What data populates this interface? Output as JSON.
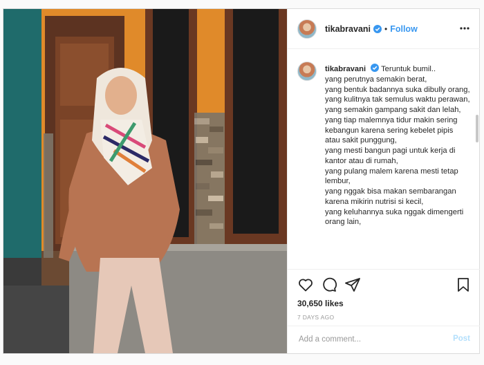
{
  "post": {
    "username": "tikabravani",
    "follow_label": "Follow",
    "separator": "•",
    "caption_intro": "Teruntuk bumil..",
    "caption_lines": "yang perutnya semakin berat,\nyang bentuk badannya suka dibully orang,\nyang kulitnya tak semulus waktu perawan,\nyang semakin gampang sakit dan lelah,\nyang tiap malemnya tidur makin sering kebangun karena sering kebelet pipis atau sakit punggung,\nyang mesti bangun pagi untuk kerja di kantor atau di rumah,\nyang pulang malem karena mesti tetap lembur,\nyang nggak bisa makan sembarangan karena mikirin nutrisi si kecil,\nyang keluhannya suka nggak dimengerti orang lain,",
    "likes": "30,650 likes",
    "time": "7 DAYS AGO",
    "comment_placeholder": "Add a comment...",
    "post_label": "Post"
  },
  "colors": {
    "accent": "#3897f0",
    "post_disabled": "#b2dffc",
    "text": "#262626",
    "muted": "#999999",
    "border": "#efefef"
  },
  "icons": [
    "verified-badge-icon",
    "more-options-icon",
    "heart-icon",
    "comment-icon",
    "share-icon",
    "bookmark-icon"
  ]
}
